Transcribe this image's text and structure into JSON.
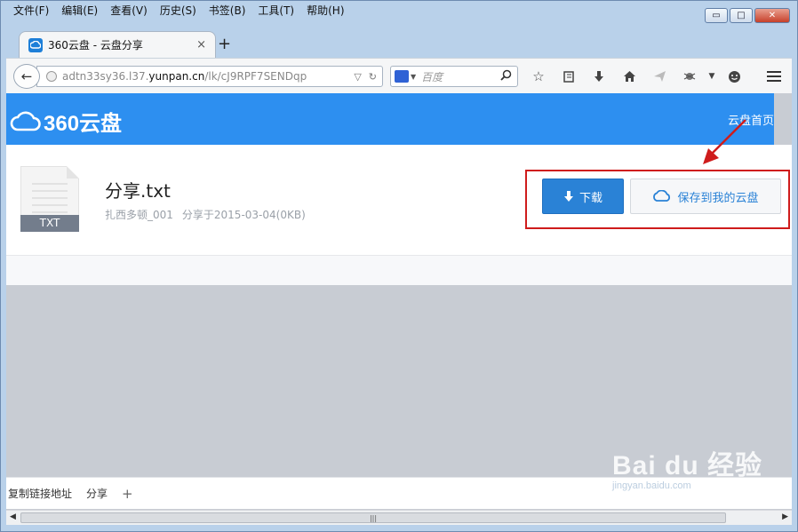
{
  "menubar": {
    "items": [
      "文件(F)",
      "编辑(E)",
      "查看(V)",
      "历史(S)",
      "书签(B)",
      "工具(T)",
      "帮助(H)"
    ]
  },
  "window_controls": {
    "minimize": "▭",
    "maximize": "□",
    "close": "✕"
  },
  "tab": {
    "title": "360云盘 - 云盘分享",
    "close": "×",
    "new_tab": "+"
  },
  "navbar": {
    "url_prefix": "adtn33sy36.l37.",
    "url_host": "yunpan.cn",
    "url_path": "/lk/cJ9RPF7SENDqp",
    "search_placeholder": "百度"
  },
  "page": {
    "logo_text": "360云盘",
    "home_link": "云盘首页",
    "file": {
      "ext": "TXT",
      "name": "分享.txt",
      "owner": "扎西多顿_001",
      "shared": "分享于2015-03-04(0KB)"
    },
    "buttons": {
      "download": "下载",
      "save": "保存到我的云盘"
    }
  },
  "bottombar": {
    "copy_link": "复制链接地址",
    "share": "分享",
    "plus": "+"
  },
  "watermark": {
    "main": "Bai du 经验",
    "sub": "jingyan.baidu.com"
  },
  "colors": {
    "brand": "#2d8ff0",
    "download_button": "#2a82d6",
    "annotation_red": "#cf1c1c"
  }
}
